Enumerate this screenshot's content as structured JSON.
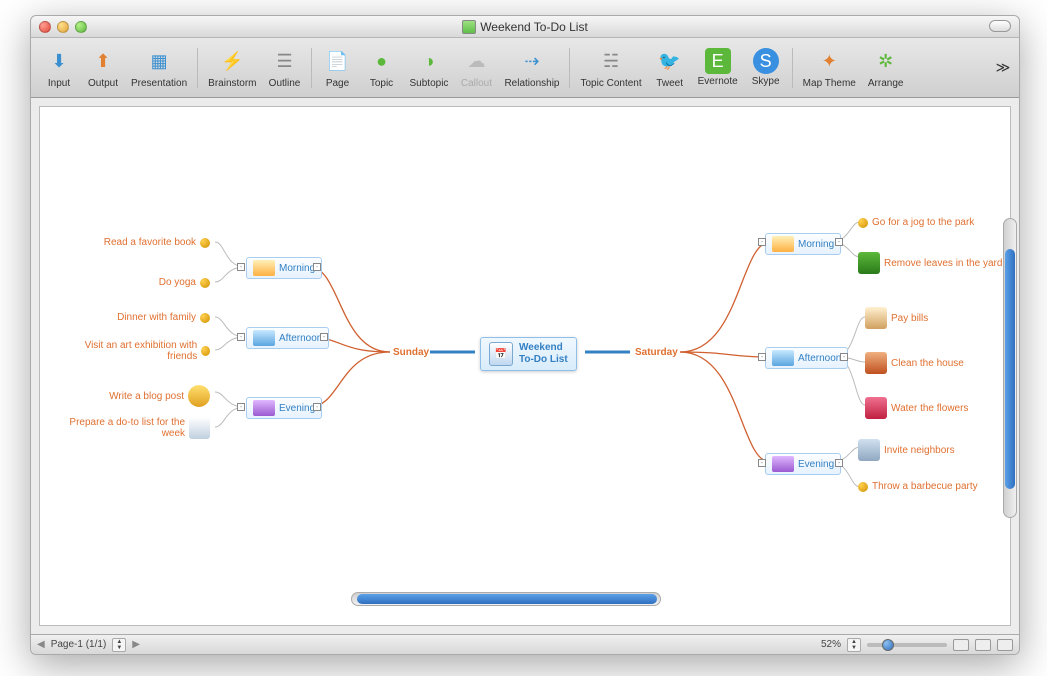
{
  "window": {
    "title": "Weekend To-Do List"
  },
  "toolbar": {
    "input": "Input",
    "output": "Output",
    "presentation": "Presentation",
    "brainstorm": "Brainstorm",
    "outline": "Outline",
    "page": "Page",
    "topic": "Topic",
    "subtopic": "Subtopic",
    "callout": "Callout",
    "relationship": "Relationship",
    "topic_content": "Topic Content",
    "tweet": "Tweet",
    "evernote": "Evernote",
    "skype": "Skype",
    "map_theme": "Map Theme",
    "arrange": "Arrange"
  },
  "center": {
    "title": "Weekend\nTo-Do List"
  },
  "days": {
    "saturday": "Saturday",
    "sunday": "Sunday"
  },
  "periods": {
    "morning": "Morning",
    "afternoon": "Afternoon",
    "evening": "Evening"
  },
  "tasks": {
    "saturday": {
      "morning": [
        "Go for a jog to the park",
        "Remove leaves in the yard"
      ],
      "afternoon": [
        "Pay bills",
        "Clean the house",
        "Water the flowers"
      ],
      "evening": [
        "Invite neighbors",
        "Throw a barbecue party"
      ]
    },
    "sunday": {
      "morning": [
        "Read a favorite book",
        "Do yoga"
      ],
      "afternoon": [
        "Dinner with family",
        "Visit an art exhibition with friends"
      ],
      "evening": [
        "Write a blog post",
        "Prepare a do-to list for the week"
      ]
    }
  },
  "statusbar": {
    "page_label": "Page-1 (1/1)",
    "zoom": "52%"
  }
}
